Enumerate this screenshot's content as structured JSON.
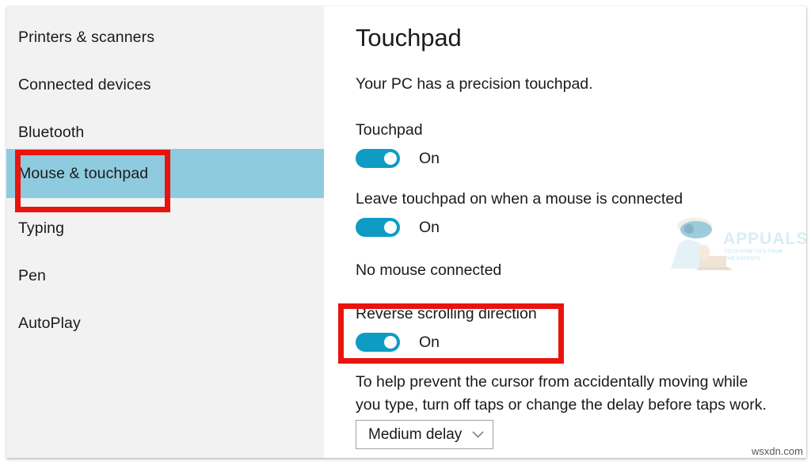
{
  "sidebar": {
    "items": [
      {
        "label": "Printers & scanners",
        "selected": false
      },
      {
        "label": "Connected devices",
        "selected": false
      },
      {
        "label": "Bluetooth",
        "selected": false
      },
      {
        "label": "Mouse & touchpad",
        "selected": true
      },
      {
        "label": "Typing",
        "selected": false
      },
      {
        "label": "Pen",
        "selected": false
      },
      {
        "label": "AutoPlay",
        "selected": false
      }
    ]
  },
  "main": {
    "title": "Touchpad",
    "subtitle": "Your PC has a precision touchpad.",
    "touchpad_setting": {
      "label": "Touchpad",
      "toggle_state": "On"
    },
    "leave_on_setting": {
      "label": "Leave touchpad on when a mouse is connected",
      "toggle_state": "On",
      "status": "No mouse connected"
    },
    "reverse_scrolling_setting": {
      "label": "Reverse scrolling direction",
      "toggle_state": "On"
    },
    "delay_help_text": "To help prevent the cursor from accidentally moving while you type, turn off taps or change the delay before taps work.",
    "delay_dropdown": {
      "selected": "Medium delay"
    }
  },
  "watermarks": {
    "appuals": "APPUALS",
    "appuals_tagline": "TECH HOW-TO'S FROM THE EXPERTS",
    "corner": "wsxdn.com"
  },
  "colors": {
    "selection_blue": "#8ecbdf",
    "toggle_on": "#0f9cc4",
    "annotation_red": "#e8140e",
    "sidebar_bg": "#f2f2f2"
  }
}
